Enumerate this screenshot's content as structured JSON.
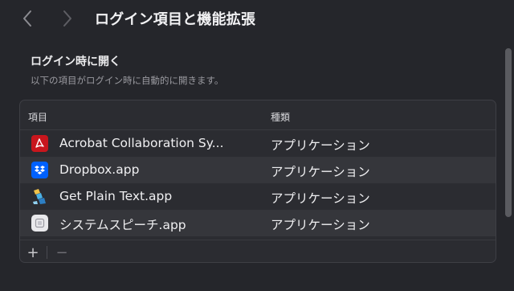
{
  "window": {
    "title": "ログイン項目と機能拡張",
    "back_icon": "chevron-left-icon",
    "forward_icon": "chevron-right-icon"
  },
  "section": {
    "title": "ログイン時に開く",
    "description": "以下の項目がログイン時に自動的に開きます。"
  },
  "table": {
    "headers": {
      "item": "項目",
      "kind": "種類"
    },
    "rows": [
      {
        "name": "Acrobat Collaboration Sy...",
        "kind": "アプリケーション",
        "icon": "acrobat-icon"
      },
      {
        "name": "Dropbox.app",
        "kind": "アプリケーション",
        "icon": "dropbox-icon"
      },
      {
        "name": "Get Plain Text.app",
        "kind": "アプリケーション",
        "icon": "get-plain-text-icon"
      },
      {
        "name": "システムスピーチ.app",
        "kind": "アプリケーション",
        "icon": "speech-app-icon"
      }
    ]
  },
  "footer": {
    "add_label": "+",
    "remove_label": "−"
  },
  "colors": {
    "background": "#25262b",
    "panel": "#2b2c31",
    "row_alt": "#35363b",
    "acrobat_red": "#c8161d",
    "dropbox_blue": "#0061fe"
  }
}
